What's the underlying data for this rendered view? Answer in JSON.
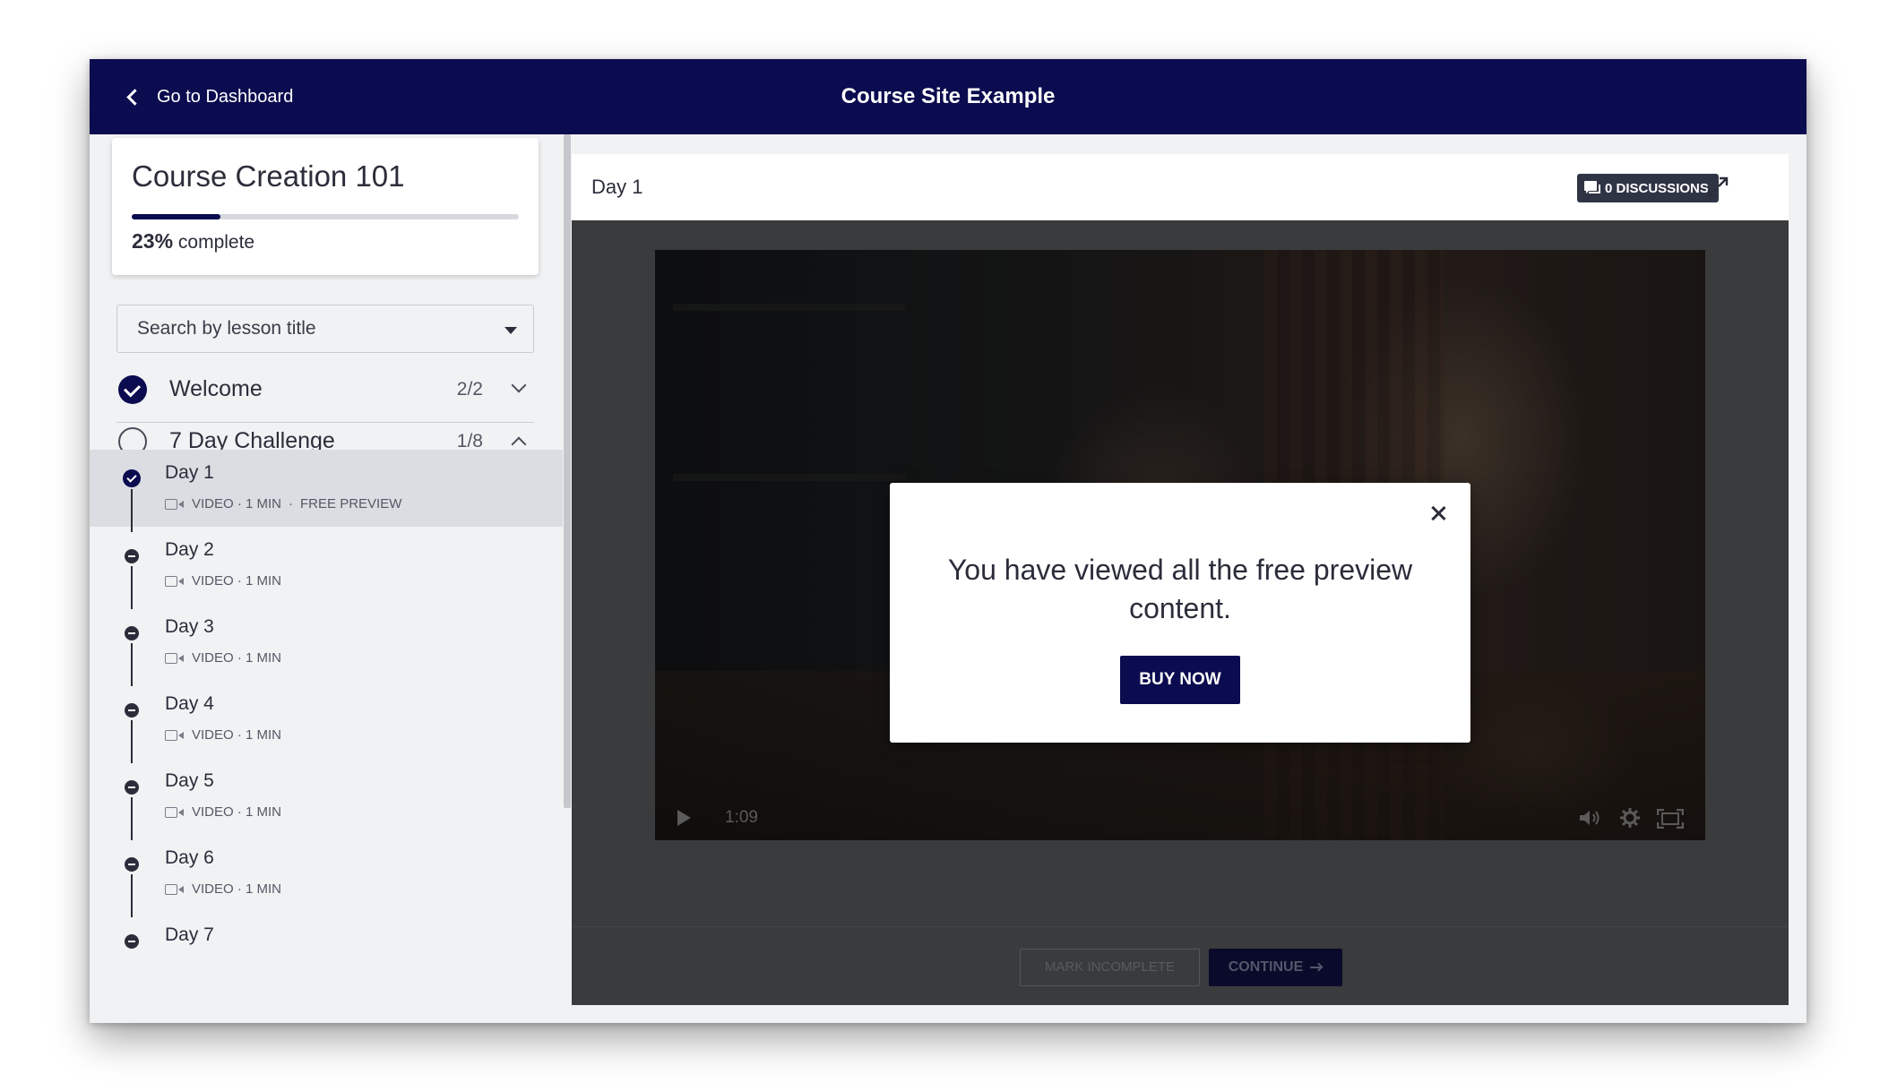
{
  "topbar": {
    "back_label": "Go to Dashboard",
    "site_title": "Course Site Example"
  },
  "course": {
    "title": "Course Creation 101",
    "progress_percent": 23,
    "progress_value": "23%",
    "progress_suffix": "complete"
  },
  "search": {
    "placeholder": "Search by lesson title"
  },
  "chapters": [
    {
      "title": "Welcome",
      "count": "2/2",
      "status": "complete",
      "expanded": false
    },
    {
      "title": "7 Day Challenge",
      "count": "1/8",
      "status": "incomplete",
      "expanded": true
    }
  ],
  "lessons": [
    {
      "title": "Day 1",
      "meta": "VIDEO · 1 MIN",
      "badge": "FREE PREVIEW",
      "status": "complete",
      "active": true
    },
    {
      "title": "Day 2",
      "meta": "VIDEO · 1 MIN",
      "status": "locked"
    },
    {
      "title": "Day 3",
      "meta": "VIDEO · 1 MIN",
      "status": "locked"
    },
    {
      "title": "Day 4",
      "meta": "VIDEO · 1 MIN",
      "status": "locked"
    },
    {
      "title": "Day 5",
      "meta": "VIDEO · 1 MIN",
      "status": "locked"
    },
    {
      "title": "Day 6",
      "meta": "VIDEO · 1 MIN",
      "status": "locked"
    },
    {
      "title": "Day 7",
      "status": "locked"
    }
  ],
  "main": {
    "lesson_title": "Day 1",
    "discussions_label": "0 DISCUSSIONS"
  },
  "player": {
    "time": "1:09"
  },
  "footer": {
    "mark_incomplete_label": "MARK INCOMPLETE",
    "continue_label": "CONTINUE"
  },
  "modal": {
    "message": "You have viewed all the free preview content.",
    "buy_label": "BUY NOW"
  },
  "colors": {
    "brand_navy": "#0b0b4f",
    "discussions_bg": "#2f3445"
  },
  "icons": [
    "chevron-left-icon",
    "caret-down-icon",
    "check-circle-icon",
    "empty-circle-icon",
    "chevron-down-icon",
    "chevron-up-icon",
    "video-camera-icon",
    "chat-icon",
    "expand-icon",
    "play-icon",
    "volume-icon",
    "settings-icon",
    "fullscreen-icon",
    "close-icon",
    "arrow-right-icon"
  ]
}
